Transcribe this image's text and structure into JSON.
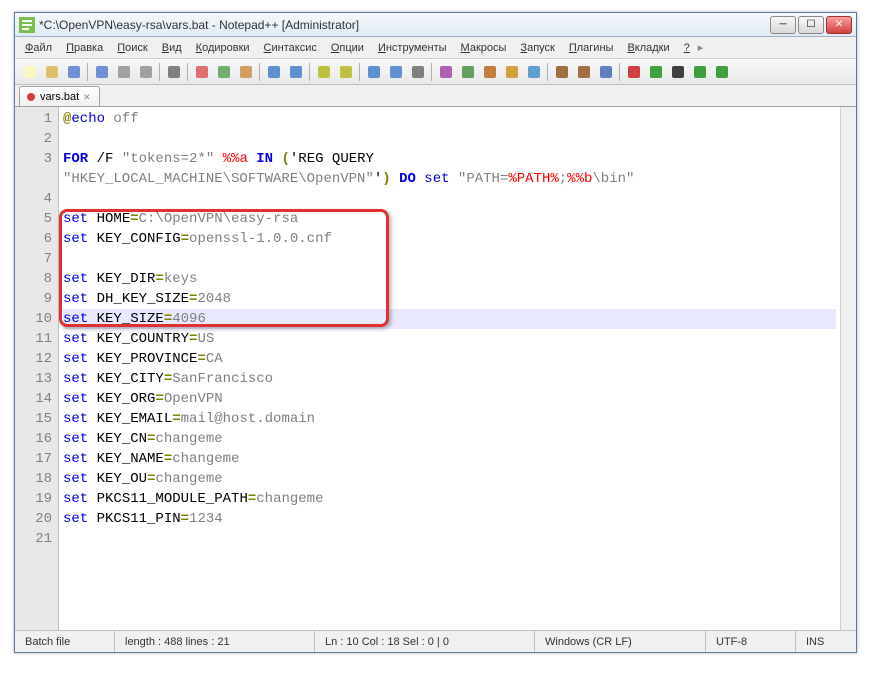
{
  "window": {
    "title": "*C:\\OpenVPN\\easy-rsa\\vars.bat - Notepad++ [Administrator]"
  },
  "menu": [
    "Файл",
    "Правка",
    "Поиск",
    "Вид",
    "Кодировки",
    "Синтаксис",
    "Опции",
    "Инструменты",
    "Макросы",
    "Запуск",
    "Плагины",
    "Вкладки",
    "?"
  ],
  "tab": {
    "name": "vars.bat"
  },
  "code": {
    "lines": [
      {
        "n": 1,
        "tokens": [
          [
            "@",
            "op"
          ],
          [
            "echo",
            "kw"
          ],
          [
            " ",
            ""
          ],
          [
            "off",
            "lit"
          ]
        ]
      },
      {
        "n": 2,
        "tokens": []
      },
      {
        "n": 3,
        "tokens": [
          [
            "FOR",
            "kw2"
          ],
          [
            " /F ",
            ""
          ],
          [
            "\"tokens=2*\"",
            "str"
          ],
          [
            " ",
            ""
          ],
          [
            "%%a",
            "pct"
          ],
          [
            " ",
            ""
          ],
          [
            "IN",
            "kw2"
          ],
          [
            " ",
            ""
          ],
          [
            "(",
            "op"
          ],
          [
            "'REG QUERY",
            ""
          ]
        ]
      },
      {
        "n": null,
        "tokens": [
          [
            "\"HKEY_LOCAL_MACHINE\\SOFTWARE\\OpenVPN\"",
            "str"
          ],
          [
            "'",
            ""
          ],
          [
            ")",
            "op"
          ],
          [
            " ",
            ""
          ],
          [
            "DO",
            "kw2"
          ],
          [
            " ",
            ""
          ],
          [
            "set",
            "kw"
          ],
          [
            " ",
            ""
          ],
          [
            "\"PATH=",
            "str"
          ],
          [
            "%PATH%",
            "pct"
          ],
          [
            ";",
            "str"
          ],
          [
            "%%b",
            "pct"
          ],
          [
            "\\bin\"",
            "str"
          ]
        ]
      },
      {
        "n": 4,
        "tokens": []
      },
      {
        "n": 5,
        "tokens": [
          [
            "set",
            "kw"
          ],
          [
            " HOME",
            ""
          ],
          [
            "=",
            "op"
          ],
          [
            "C:\\OpenVPN\\easy-rsa",
            "lit"
          ]
        ]
      },
      {
        "n": 6,
        "tokens": [
          [
            "set",
            "kw"
          ],
          [
            " KEY_CONFIG",
            ""
          ],
          [
            "=",
            "op"
          ],
          [
            "openssl-1.0.0.cnf",
            "lit"
          ]
        ]
      },
      {
        "n": 7,
        "tokens": []
      },
      {
        "n": 8,
        "tokens": [
          [
            "set",
            "kw"
          ],
          [
            " KEY_DIR",
            ""
          ],
          [
            "=",
            "op"
          ],
          [
            "keys",
            "lit"
          ]
        ]
      },
      {
        "n": 9,
        "tokens": [
          [
            "set",
            "kw"
          ],
          [
            " DH_KEY_SIZE",
            ""
          ],
          [
            "=",
            "op"
          ],
          [
            "2048",
            "lit"
          ]
        ]
      },
      {
        "n": 10,
        "tokens": [
          [
            "set",
            "kw"
          ],
          [
            " KEY_SIZE",
            ""
          ],
          [
            "=",
            "op"
          ],
          [
            "4096",
            "lit"
          ]
        ],
        "current": true
      },
      {
        "n": 11,
        "tokens": [
          [
            "set",
            "kw"
          ],
          [
            " KEY_COUNTRY",
            ""
          ],
          [
            "=",
            "op"
          ],
          [
            "US",
            "lit"
          ]
        ]
      },
      {
        "n": 12,
        "tokens": [
          [
            "set",
            "kw"
          ],
          [
            " KEY_PROVINCE",
            ""
          ],
          [
            "=",
            "op"
          ],
          [
            "CA",
            "lit"
          ]
        ]
      },
      {
        "n": 13,
        "tokens": [
          [
            "set",
            "kw"
          ],
          [
            " KEY_CITY",
            ""
          ],
          [
            "=",
            "op"
          ],
          [
            "SanFrancisco",
            "lit"
          ]
        ]
      },
      {
        "n": 14,
        "tokens": [
          [
            "set",
            "kw"
          ],
          [
            " KEY_ORG",
            ""
          ],
          [
            "=",
            "op"
          ],
          [
            "OpenVPN",
            "lit"
          ]
        ]
      },
      {
        "n": 15,
        "tokens": [
          [
            "set",
            "kw"
          ],
          [
            " KEY_EMAIL",
            ""
          ],
          [
            "=",
            "op"
          ],
          [
            "mail@host.domain",
            "lit"
          ]
        ]
      },
      {
        "n": 16,
        "tokens": [
          [
            "set",
            "kw"
          ],
          [
            " KEY_CN",
            ""
          ],
          [
            "=",
            "op"
          ],
          [
            "changeme",
            "lit"
          ]
        ]
      },
      {
        "n": 17,
        "tokens": [
          [
            "set",
            "kw"
          ],
          [
            " KEY_NAME",
            ""
          ],
          [
            "=",
            "op"
          ],
          [
            "changeme",
            "lit"
          ]
        ]
      },
      {
        "n": 18,
        "tokens": [
          [
            "set",
            "kw"
          ],
          [
            " KEY_OU",
            ""
          ],
          [
            "=",
            "op"
          ],
          [
            "changeme",
            "lit"
          ]
        ]
      },
      {
        "n": 19,
        "tokens": [
          [
            "set",
            "kw"
          ],
          [
            " PKCS11_MODULE_PATH",
            ""
          ],
          [
            "=",
            "op"
          ],
          [
            "changeme",
            "lit"
          ]
        ]
      },
      {
        "n": 20,
        "tokens": [
          [
            "set",
            "kw"
          ],
          [
            " PKCS11_PIN",
            ""
          ],
          [
            "=",
            "op"
          ],
          [
            "1234",
            "lit"
          ]
        ]
      },
      {
        "n": 21,
        "tokens": []
      }
    ]
  },
  "status": {
    "lang": "Batch file",
    "length": "length : 488    lines : 21",
    "pos": "Ln : 10    Col : 18    Sel : 0 | 0",
    "eol": "Windows (CR LF)",
    "enc": "UTF-8",
    "mode": "INS"
  },
  "toolbar_icons": [
    "new",
    "open",
    "save",
    "saveall",
    "close",
    "closeall",
    "print",
    "cut",
    "copy",
    "paste",
    "undo",
    "redo",
    "find",
    "replace",
    "zoomin",
    "zoomout",
    "wrap",
    "allchars",
    "indent",
    "lang",
    "folder",
    "func",
    "comment",
    "uncomment",
    "bookmark",
    "record",
    "play",
    "stop",
    "playlist",
    "run"
  ]
}
